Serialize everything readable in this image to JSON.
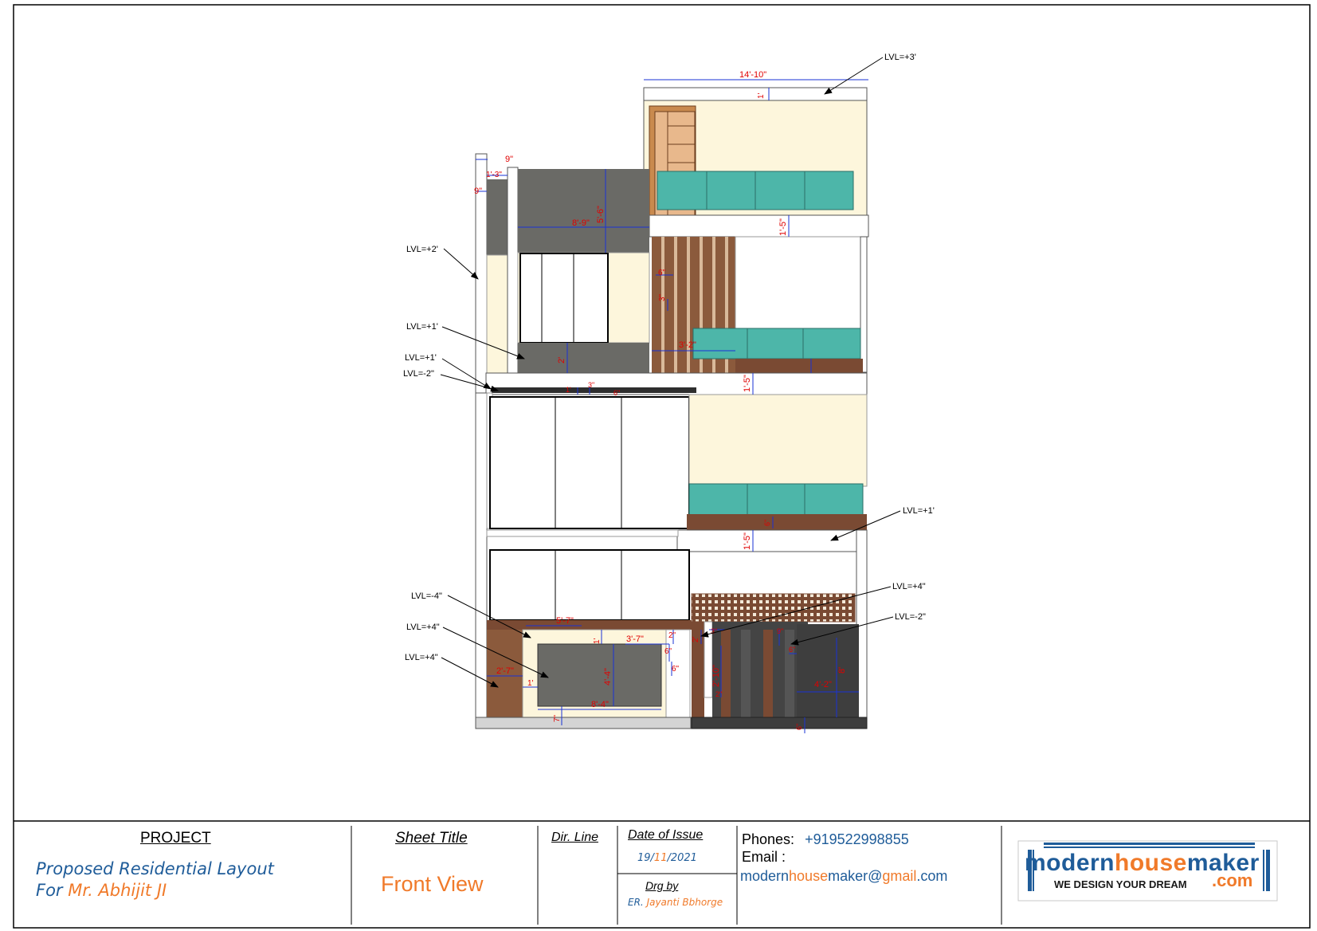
{
  "colors": {
    "red_dim": "#e00000",
    "blue_dim": "#1a33d6",
    "glass": "#4db6a9",
    "cream": "#fdf6dc",
    "wood": "#7a4a33",
    "dark_grey": "#6a6a66",
    "charcoal": "#3e3e3e",
    "orange_text": "#f07a2a",
    "blue_text": "#1f5c99"
  },
  "drawing": {
    "dims": {
      "overall_width": "14'-10\"",
      "parapet": "1'",
      "d_9a": "9\"",
      "d_1_3": "1'-3\"",
      "d_9b": "9\"",
      "wall_width": "8'-9\"",
      "wall_height": "5'-6\"",
      "slab_top": "1'-5\"",
      "d_2": "2'",
      "d_6a": "6\"",
      "d_3": "3\"",
      "louver_w": "3'-2\"",
      "slab_mid": "1'-5\"",
      "d_3b": "3\"",
      "d_1b": "1'",
      "d_6b": "6\"",
      "d_6c": "6\"",
      "slab_low": "1'-5\"",
      "d_5_7": "5'-7\"",
      "d_3_7": "3'-7\"",
      "d_1c": "1'",
      "d_2b": "2\"",
      "d_6d": "6\"",
      "d_6e": "6\"",
      "d_4_4": "4'-4\"",
      "d_8_4": "8'-4\"",
      "d_2_7": "2'-7\"",
      "d_1d": "1'",
      "d_7": "7\"",
      "d_2c": "2'",
      "d_3c": "3\"",
      "d_2_10": "2'-10\"",
      "d_2d": "2\"",
      "d_9c": "9\"",
      "d_6f": "6\"",
      "d_4_2": "4'-2\"",
      "d_8": "8'",
      "d_6g": "6\""
    },
    "levels": {
      "l1": "LVL=+3'",
      "l2": "LVL=+2'",
      "l3": "LVL=+1'",
      "l4": "LVL=+1'",
      "l5": "LVL=-2\"",
      "l6": "LVL=+1'",
      "l7": "LVL=+4\"",
      "l8": "LVL=-4\"",
      "l9": "LVL=-2\"",
      "l10": "LVL=+4\"",
      "l11": "LVL=+4\""
    }
  },
  "title_block": {
    "project_heading": "PROJECT",
    "project_line1": "Proposed Residential Layout",
    "project_line2_prefix": "For ",
    "project_client": "Mr. Abhijit JI",
    "sheet_title_heading": "Sheet Title",
    "sheet_title": "Front View",
    "dir_line": "Dir. Line",
    "date_heading": "Date of Issue",
    "date_day": "19/",
    "date_month": "11",
    "date_year": "/2021",
    "drg_heading": "Drg by",
    "drg_prefix": "ER. ",
    "drg_name": "Jayanti Bbhorge",
    "phones_label": "Phones:",
    "phone": "+919522998855",
    "email_label": "Email :",
    "email_part1": "modern",
    "email_part2": "house",
    "email_part3": "maker@",
    "email_part4": "gmail",
    "email_part5": ".com",
    "logo_modern": "modern",
    "logo_house": "house",
    "logo_maker": "maker",
    "logo_tagline": "WE DESIGN YOUR DREAM",
    "logo_com": ".com"
  }
}
